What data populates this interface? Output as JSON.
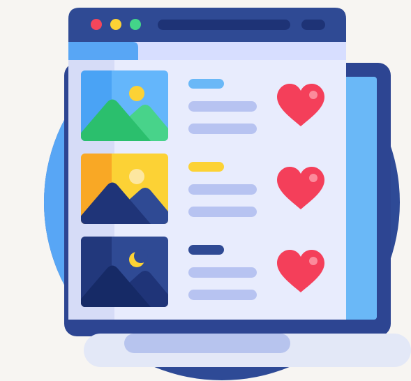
{
  "illustration": {
    "colors": {
      "background": "#f7f5f2",
      "backdrop_circle": "#2e4a96",
      "backdrop_circle_light": "#58a6f5",
      "laptop_frame": "#2d4592",
      "laptop_screen": "#6ab8f7",
      "laptop_base": "#e3e8f7",
      "laptop_base_shadow": "#b7c4ee",
      "window_titlebar": "#2f4a94",
      "window_url_bar": "#1e3376",
      "window_header_band": "#d7deff",
      "window_body": "#e8ecfd",
      "window_body_left": "#d6dcf7",
      "dot_red": "#f4465b",
      "dot_yellow": "#fcd235",
      "dot_green": "#43d589",
      "heart": "#f43f5a",
      "heart_highlight": "#fb8b9b",
      "text_line": "#b7c3f1"
    },
    "window": {
      "traffic_lights": [
        "dot-red",
        "dot-yellow",
        "dot-green"
      ]
    },
    "items": [
      {
        "thumbnail": "mountain-day-icon",
        "sky": "#64b6fb",
        "sky_left": "#4aa3f5",
        "orb": "#fcd235",
        "orb_kind": "sun",
        "mountain_back": "#48d38a",
        "mountain_front": "#2bbf6d",
        "tag_color": "#6ab8f7",
        "liked": true
      },
      {
        "thumbnail": "mountain-sunset-icon",
        "sky": "#fcd235",
        "sky_left": "#f9a825",
        "orb": "#fde7a0",
        "orb_kind": "sun",
        "mountain_back": "#2f4a94",
        "mountain_front": "#1f3478",
        "tag_color": "#fcd235",
        "liked": true
      },
      {
        "thumbnail": "mountain-night-icon",
        "sky": "#2f4a94",
        "sky_left": "#22387c",
        "orb": "#fcd235",
        "orb_kind": "moon",
        "mountain_back": "#1f3478",
        "mountain_front": "#162a66",
        "tag_color": "#2f4a94",
        "liked": true
      }
    ]
  }
}
